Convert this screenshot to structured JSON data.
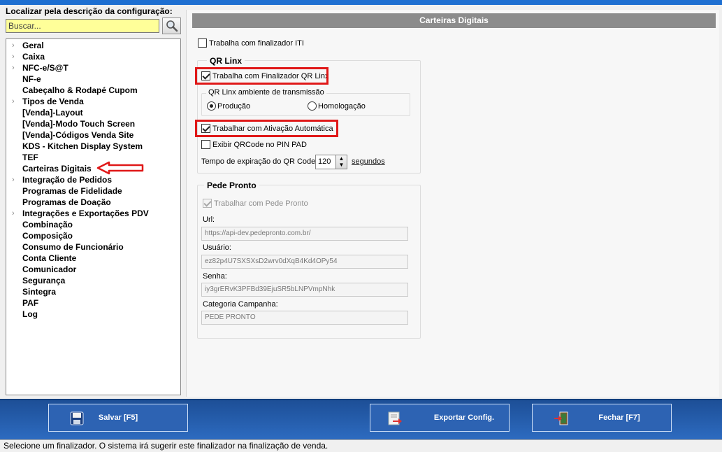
{
  "search": {
    "label": "Localizar pela descrição da configuração:",
    "placeholder": "Buscar..."
  },
  "tree": {
    "items": [
      {
        "label": "Geral",
        "expandable": true
      },
      {
        "label": "Caixa",
        "expandable": true
      },
      {
        "label": "NFC-e/S@T",
        "expandable": true
      },
      {
        "label": "NF-e",
        "expandable": false
      },
      {
        "label": "Cabeçalho & Rodapé Cupom",
        "expandable": false
      },
      {
        "label": "Tipos de Venda",
        "expandable": true
      },
      {
        "label": "[Venda]-Layout",
        "expandable": false
      },
      {
        "label": "[Venda]-Modo Touch Screen",
        "expandable": false
      },
      {
        "label": "[Venda]-Códigos Venda Site",
        "expandable": false
      },
      {
        "label": "KDS - Kitchen Display System",
        "expandable": false
      },
      {
        "label": "TEF",
        "expandable": false
      },
      {
        "label": "Carteiras Digitais",
        "expandable": false
      },
      {
        "label": "Integração de Pedidos",
        "expandable": true
      },
      {
        "label": "Programas de Fidelidade",
        "expandable": false
      },
      {
        "label": "Programas de Doação",
        "expandable": false
      },
      {
        "label": "Integrações e Exportações PDV",
        "expandable": true
      },
      {
        "label": "Combinação",
        "expandable": false
      },
      {
        "label": "Composição",
        "expandable": false
      },
      {
        "label": "Consumo de Funcionário",
        "expandable": false
      },
      {
        "label": "Conta Cliente",
        "expandable": false
      },
      {
        "label": "Comunicador",
        "expandable": false
      },
      {
        "label": "Segurança",
        "expandable": false
      },
      {
        "label": "Sintegra",
        "expandable": false
      },
      {
        "label": "PAF",
        "expandable": false
      },
      {
        "label": "Log",
        "expandable": false
      }
    ]
  },
  "panel": {
    "title": "Carteiras Digitais",
    "iti": {
      "label": "Trabalha com finalizador ITI",
      "checked": false
    },
    "qr_linx": {
      "title": "QR Linx",
      "finalizador": {
        "label": "Trabalha com Finalizador QR Linx",
        "checked": true
      },
      "ambiente": {
        "title": "QR Linx ambiente de transmissão",
        "producao": "Produção",
        "homologacao": "Homologação",
        "selected": "Produção"
      },
      "ativacao": {
        "label": "Trabalhar com Ativação Automática",
        "checked": true
      },
      "pinpad": {
        "label": "Exibir QRCode no PIN PAD",
        "checked": false
      },
      "expiracao_label": "Tempo de expiração do QR Code",
      "expiracao_value": "120",
      "expiracao_unit": "segundos"
    },
    "pede_pronto": {
      "title": "Pede Pronto",
      "trabalhar": {
        "label": "Trabalhar com Pede Pronto",
        "checked": true,
        "enabled": false
      },
      "url_label": "Url:",
      "url_value": "https://api-dev.pedepronto.com.br/",
      "usuario_label": "Usuário:",
      "usuario_value": "ez82p4U7SXSXsD2wrv0dXqB4Kd4OPy54",
      "senha_label": "Senha:",
      "senha_value": "iy3grERvK3PFBd39EjuSR5bLNPVmpNhk",
      "categoria_label": "Categoria Campanha:",
      "categoria_value": "PEDE PRONTO"
    }
  },
  "buttons": {
    "save": "Salvar [F5]",
    "export": "Exportar Config.",
    "close": "Fechar [F7]"
  },
  "status": "Selecione um finalizador. O sistema irá sugerir este finalizador na finalização de venda.",
  "colors": {
    "highlight": "#e01818",
    "bottom_bar": "#2d63b3",
    "search_bg": "#ffff99",
    "header_bg": "#8c8c8c"
  }
}
